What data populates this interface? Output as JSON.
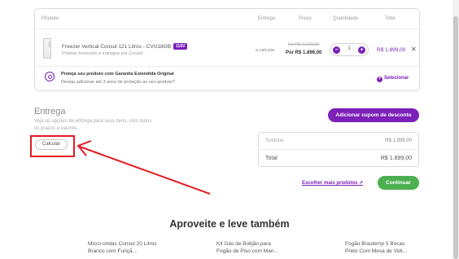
{
  "cart": {
    "headers": {
      "produto": "Produto",
      "entrega": "Entrega",
      "preco": "Preço",
      "quantidade": "Quantidade",
      "total": "Total"
    },
    "item": {
      "name": "Freezer Vertical Consul 121 Litros - CVU18GB",
      "badge": "110V",
      "seller": "Produto fornecido e entregue por Consul",
      "delivery": "a calcular",
      "old_price": "De R$ 2.229,00",
      "new_price": "Por R$ 1.899,00",
      "quantity": "1",
      "total": "R$ 1.899,00",
      "minus_icon": "minus-icon",
      "plus_icon": "plus-icon",
      "remove_icon": "close-icon"
    },
    "protection": {
      "title": "Proteja seu produto com Garantia Estendida Original",
      "subtitle": "Deseja adicionar até 3 anos de proteção ao seu produto?",
      "select_label": "Selecionar"
    }
  },
  "entrega": {
    "title": "Entrega",
    "description": "Veja as opções de entrega para seus itens, com todos os prazos e valores.",
    "calc_button": "Calcular"
  },
  "coupon_button": "Adicionar cupom de desconto",
  "summary": {
    "subtotal_label": "Subtotal",
    "subtotal_value": "R$ 1.899,00",
    "total_label": "Total",
    "total_value": "R$ 1.899,00"
  },
  "actions": {
    "choose_more": "Escolher mais produtos",
    "continue": "Continuar"
  },
  "recommendations": {
    "title": "Aproveite e leve também",
    "items": [
      {
        "name_line1": "Micro-ondas Consul 20 Litros",
        "name_line2": "Branco com Funçã..."
      },
      {
        "name_line1": "Kit Gás de Botijão para",
        "name_line2": "Fogão de Piso com Man..."
      },
      {
        "name_line1": "Fogão Brastemp 5 Bocas",
        "name_line2": "Preto Com Mesa de Vidr..."
      }
    ]
  },
  "colors": {
    "brand_purple": "#7b20b8",
    "continue_green": "#4caf50",
    "annotation_red": "#e21b23"
  }
}
